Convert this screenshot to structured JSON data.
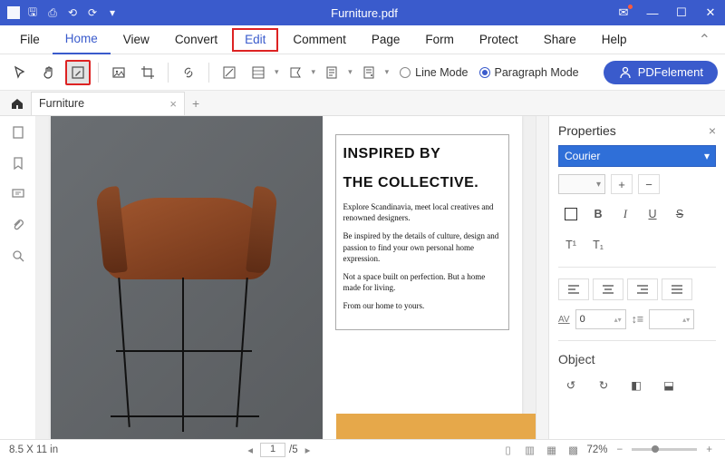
{
  "title": "Furniture.pdf",
  "menu": {
    "file": "File",
    "home": "Home",
    "view": "View",
    "convert": "Convert",
    "edit": "Edit",
    "comment": "Comment",
    "page": "Page",
    "form": "Form",
    "protect": "Protect",
    "share": "Share",
    "help": "Help"
  },
  "toolbar": {
    "line_mode": "Line Mode",
    "paragraph_mode": "Paragraph Mode",
    "brand": "PDFelement"
  },
  "tab": {
    "name": "Furniture"
  },
  "doc": {
    "headline1": "INSPIRED BY",
    "headline2": "THE COLLECTIVE.",
    "p1": "Explore Scandinavia, meet local creatives and renowned designers.",
    "p2": "Be inspired by the details of culture, design and passion to find your own personal home expression.",
    "p3": "Not a space built on perfection. But a home made for living.",
    "p4": "From our home to yours."
  },
  "props": {
    "title": "Properties",
    "font": "Courier",
    "bold": "B",
    "italic": "I",
    "underline": "U",
    "strike": "S",
    "sup": "T¹",
    "sub": "T₁",
    "letter_spacing_label": "AV",
    "letter_spacing": "0",
    "line_spacing_icon": "↕",
    "object": "Object"
  },
  "status": {
    "dims": "8.5 X 11 in",
    "page": "1",
    "total": "/5",
    "zoom": "72%"
  }
}
